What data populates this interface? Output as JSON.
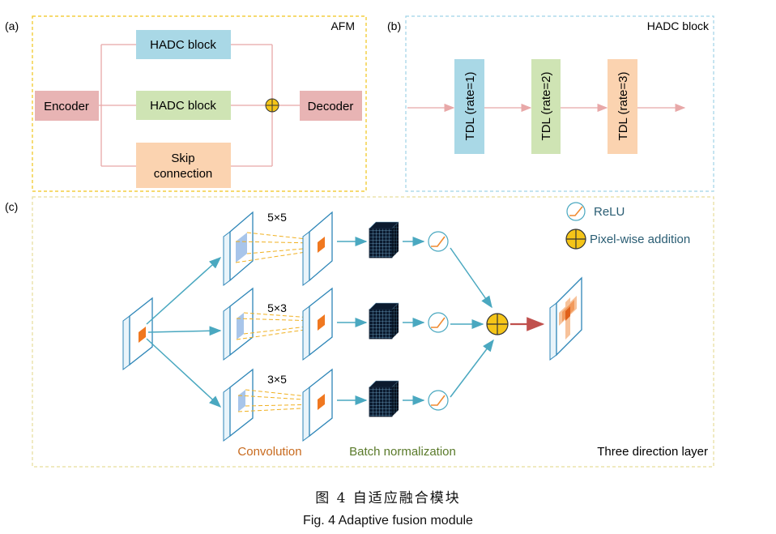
{
  "panels": {
    "a": {
      "label": "(a)",
      "title": "AFM",
      "encoder": "Encoder",
      "decoder": "Decoder",
      "hadc_top": "HADC block",
      "hadc_mid": "HADC block",
      "skip_line1": "Skip",
      "skip_line2": "connection"
    },
    "b": {
      "label": "(b)",
      "title": "HADC block",
      "tdl": [
        "TDL (rate=1)",
        "TDL (rate=2)",
        "TDL (rate=3)"
      ]
    },
    "c": {
      "label": "(c)",
      "kernels": [
        "5×5",
        "5×3",
        "3×5"
      ],
      "legend_relu": "ReLU",
      "legend_add": "Pixel-wise addition",
      "convolution": "Convolution",
      "batch_norm": "Batch normalization",
      "layer_name": "Three direction layer"
    }
  },
  "caption": {
    "zh": "图 4 自适应融合模块",
    "en": "Fig. 4   Adaptive fusion module"
  },
  "colors": {
    "panel_border_a": "#f0c419",
    "panel_border_b": "#9fd3e6",
    "panel_border_c": "#e6dd9a",
    "encoder_fill": "#e8b4b4",
    "hadc_top_fill": "#a9d8e6",
    "hadc_mid_fill": "#cfe4b4",
    "skip_fill": "#fbd3b0",
    "tdl1_fill": "#a9d8e6",
    "tdl2_fill": "#cfe4b4",
    "tdl3_fill": "#fbd3b0",
    "flow_line": "#e8a8a8",
    "teal_arrow": "#4aa8c0",
    "orange_text": "#c86a1e",
    "green_text": "#5a7a2a",
    "adder_fill": "#f5c518"
  }
}
